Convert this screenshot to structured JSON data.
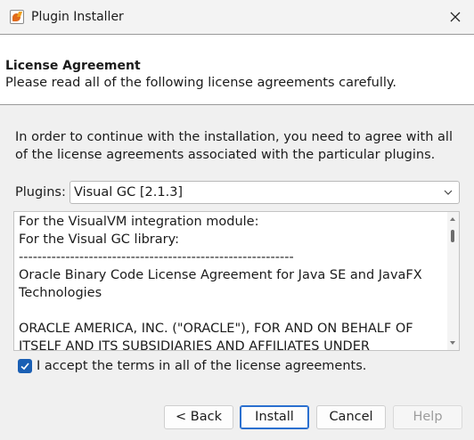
{
  "window": {
    "title": "Plugin Installer"
  },
  "header": {
    "title": "License Agreement",
    "description": "Please read all of the following license agreements carefully."
  },
  "intro": {
    "line1": "In order to continue with the installation, you need to agree with all",
    "line2": "of the license agreements associated with the particular plugins."
  },
  "plugins": {
    "label": "Plugins:",
    "selected": "Visual GC [2.1.3]"
  },
  "license": {
    "lines": [
      "For the VisualVM integration module:",
      "For the Visual GC library:",
      "-----------------------------------------------------------",
      "Oracle Binary Code License Agreement for Java SE and JavaFX",
      "Technologies",
      "",
      "ORACLE AMERICA, INC. (\"ORACLE\"), FOR AND ON BEHALF OF",
      "ITSELF AND ITS SUBSIDIARIES AND AFFILIATES UNDER"
    ]
  },
  "accept": {
    "label": "I accept the terms in all of the license agreements.",
    "checked": true
  },
  "buttons": {
    "back": "< Back",
    "install": "Install",
    "cancel": "Cancel",
    "help": "Help"
  },
  "colors": {
    "accent": "#1a5fb4",
    "icon_orange": "#e06a1c"
  }
}
